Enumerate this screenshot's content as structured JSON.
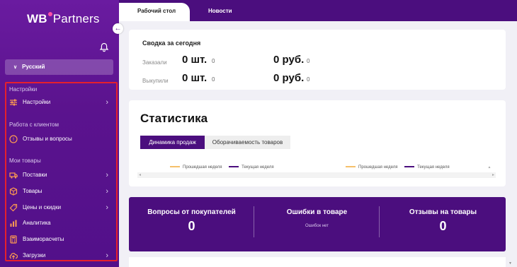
{
  "sidebar": {
    "logo": {
      "wb": "WB",
      "partners": "Partners"
    },
    "language": "Русский",
    "sections": {
      "settings": "Настройки",
      "clients": "Работа с клиентом",
      "goods": "Мои товары"
    },
    "items": [
      {
        "label": "Настройки",
        "icon": "sliders-icon"
      },
      {
        "label": "Отзывы и вопросы",
        "icon": "question-circle-icon"
      },
      {
        "label": "Поставки",
        "icon": "truck-icon"
      },
      {
        "label": "Товары",
        "icon": "box-icon"
      },
      {
        "label": "Цены и скидки",
        "icon": "tag-icon"
      },
      {
        "label": "Аналитика",
        "icon": "analytics-icon"
      },
      {
        "label": "Взаиморасчеты",
        "icon": "calculator-icon"
      },
      {
        "label": "Загрузки",
        "icon": "cloud-upload-icon"
      }
    ]
  },
  "tabs": {
    "dashboard": "Рабочий стол",
    "news": "Новости"
  },
  "summary": {
    "title": "Сводка за сегодня",
    "rows": [
      {
        "label": "Заказали",
        "qty": "0 шт.",
        "qty_small": "0",
        "sum": "0 руб.",
        "sum_small": "0"
      },
      {
        "label": "Выкупили",
        "qty": "0 шт.",
        "qty_small": "0",
        "sum": "0 руб.",
        "sum_small": "0"
      }
    ]
  },
  "stats": {
    "title": "Статистика",
    "tab_active": "Динамика продаж",
    "tab_other": "Оборачиваемость товаров",
    "legend_prev": "Прошедшая неделя",
    "legend_curr": "Текущая неделя",
    "colors": {
      "prev": "#f5c06a",
      "curr": "#4b0e7e"
    }
  },
  "panel": {
    "questions": {
      "title": "Вопросы от покупателей",
      "value": "0"
    },
    "errors": {
      "title": "Ошибки в товаре",
      "note": "Ошибок нет"
    },
    "reviews": {
      "title": "Отзывы на товары",
      "value": "0"
    }
  },
  "colors": {
    "brand": "#4b0e7e",
    "highlight": "#e6202c"
  }
}
